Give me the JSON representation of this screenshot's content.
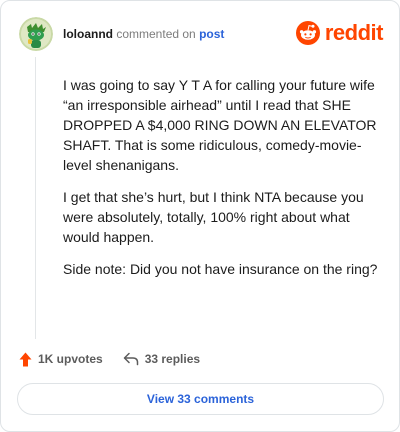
{
  "header": {
    "username": "loloannd",
    "action_text": "commented on",
    "post_link": "post",
    "avatar_icon": "snoo-avatar-icon",
    "brand_icon": "reddit-logo-icon",
    "brand_name": "reddit",
    "brand_color": "#ff4500"
  },
  "comment": {
    "paragraphs": [
      "I was going to say Y T A for calling your future wife “an irresponsible airhead” until I read that SHE DROPPED A $4,000 RING DOWN AN ELEVATOR SHAFT. That is some ridiculous, comedy-movie-level shenanigans.",
      "I get that she’s hurt, but I think NTA because you were absolutely, totally, 100% right about what would happen.",
      "Side note: Did you not have insurance on the ring?"
    ]
  },
  "actions": {
    "upvotes_label": "1K upvotes",
    "upvote_icon": "upvote-arrow-icon",
    "replies_label": "33 replies",
    "reply_icon": "reply-arrow-icon",
    "upvote_color": "#ff4500"
  },
  "footer": {
    "view_comments_label": "View 33 comments",
    "link_color": "#2b63d9"
  }
}
